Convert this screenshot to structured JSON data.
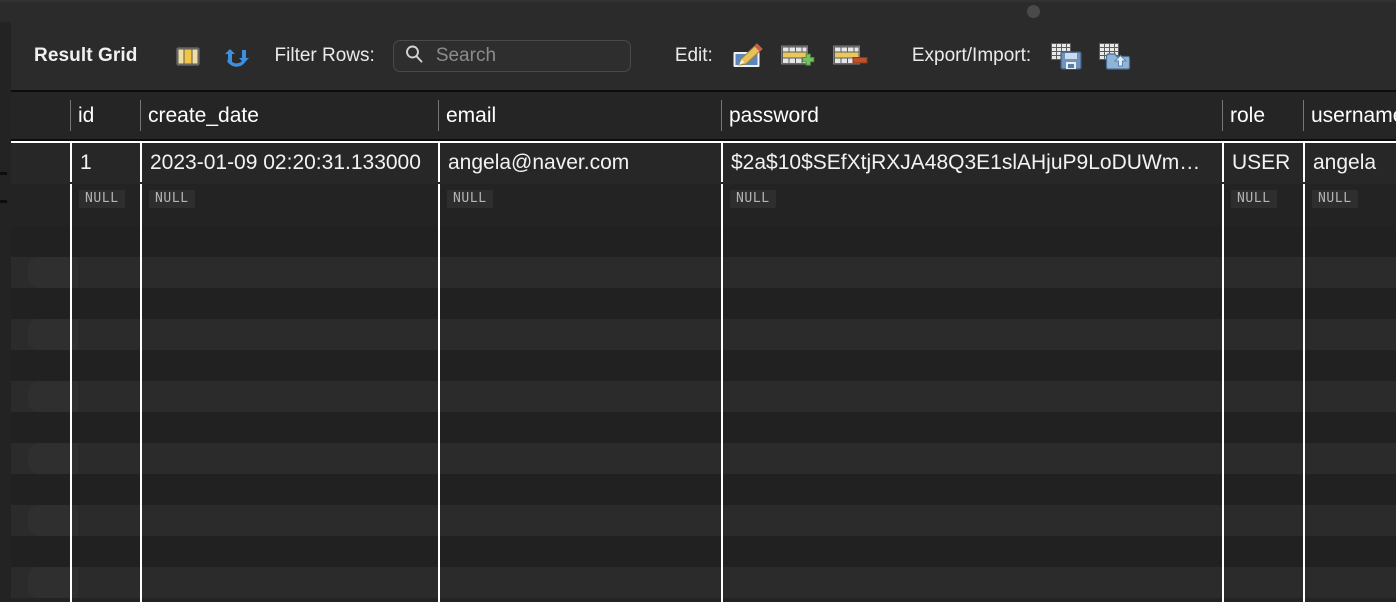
{
  "window": {
    "grab_handle": "window-grab-dot"
  },
  "toolbar": {
    "title": "Result Grid",
    "toggle_grid_icon": "grid-columns-icon",
    "refresh_icon": "refresh-icon",
    "filter_label": "Filter Rows:",
    "search": {
      "placeholder": "Search",
      "value": "",
      "icon": "search-icon"
    },
    "edit_label": "Edit:",
    "edit_actions": [
      {
        "name": "edit-row-button",
        "icon": "pencil-edit-icon"
      },
      {
        "name": "insert-row-button",
        "icon": "table-add-row-icon"
      },
      {
        "name": "delete-row-button",
        "icon": "table-delete-row-icon"
      }
    ],
    "export_import_label": "Export/Import:",
    "export_import_actions": [
      {
        "name": "export-recordset-button",
        "icon": "table-save-floppy-icon"
      },
      {
        "name": "import-recordset-button",
        "icon": "table-import-folder-icon"
      }
    ]
  },
  "grid": {
    "columns": [
      {
        "key": "id",
        "label": "id"
      },
      {
        "key": "create_date",
        "label": "create_date"
      },
      {
        "key": "email",
        "label": "email"
      },
      {
        "key": "password",
        "label": "password"
      },
      {
        "key": "role",
        "label": "role"
      },
      {
        "key": "username",
        "label": "username"
      }
    ],
    "rows": [
      {
        "id": "1",
        "create_date": "2023-01-09 02:20:31.133000",
        "email": "angela@naver.com",
        "password": "$2a$10$SEfXtjRXJA48Q3E1slAHjuP9LoDUWm…",
        "role": "USER",
        "username": "angela"
      }
    ],
    "null_row": {
      "id": "NULL",
      "create_date": "NULL",
      "email": "NULL",
      "password": "NULL",
      "role": "NULL",
      "username": "NULL"
    },
    "empty_row_count": 12
  },
  "colors": {
    "background": "#1e1e1e",
    "toolbar_bg": "#2b2b2b",
    "grid_bg": "#232323",
    "row_stripe": "#2b2b2b",
    "grid_line": "#ffffff",
    "text": "#f2f2f2",
    "placeholder": "#8c8c8c",
    "null_badge_text": "#b4b4b4",
    "accent_blue": "#3d8fe0",
    "accent_yellow": "#e8c15a"
  }
}
